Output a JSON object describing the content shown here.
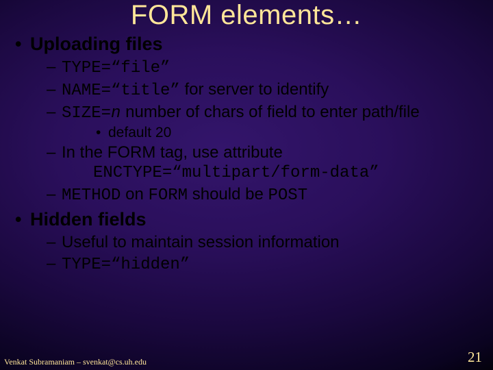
{
  "title": "FORM elements…",
  "topic1": {
    "heading": "Uploading files",
    "b1": {
      "code": "TYPE=“file”"
    },
    "b2": {
      "code": "NAME=“title”",
      "text": " for server to identify"
    },
    "b3": {
      "code": "SIZE=",
      "var": "n",
      "text": " number of chars of field to enter path/file",
      "sub": {
        "text": "default 20"
      }
    },
    "b4": {
      "text": "In the FORM tag, use attribute",
      "codeLine": "ENCTYPE=“multipart/form-data”"
    },
    "b5": {
      "code1": "METHOD",
      "t1": " on ",
      "code2": "FORM",
      "t2": " should be ",
      "code3": "POST"
    }
  },
  "topic2": {
    "heading": "Hidden fields",
    "b1": {
      "text": "Useful to maintain session information"
    },
    "b2": {
      "code": "TYPE=“hidden”"
    }
  },
  "footer": {
    "author": "Venkat Subramaniam – svenkat@cs.uh.edu",
    "page": "21"
  }
}
